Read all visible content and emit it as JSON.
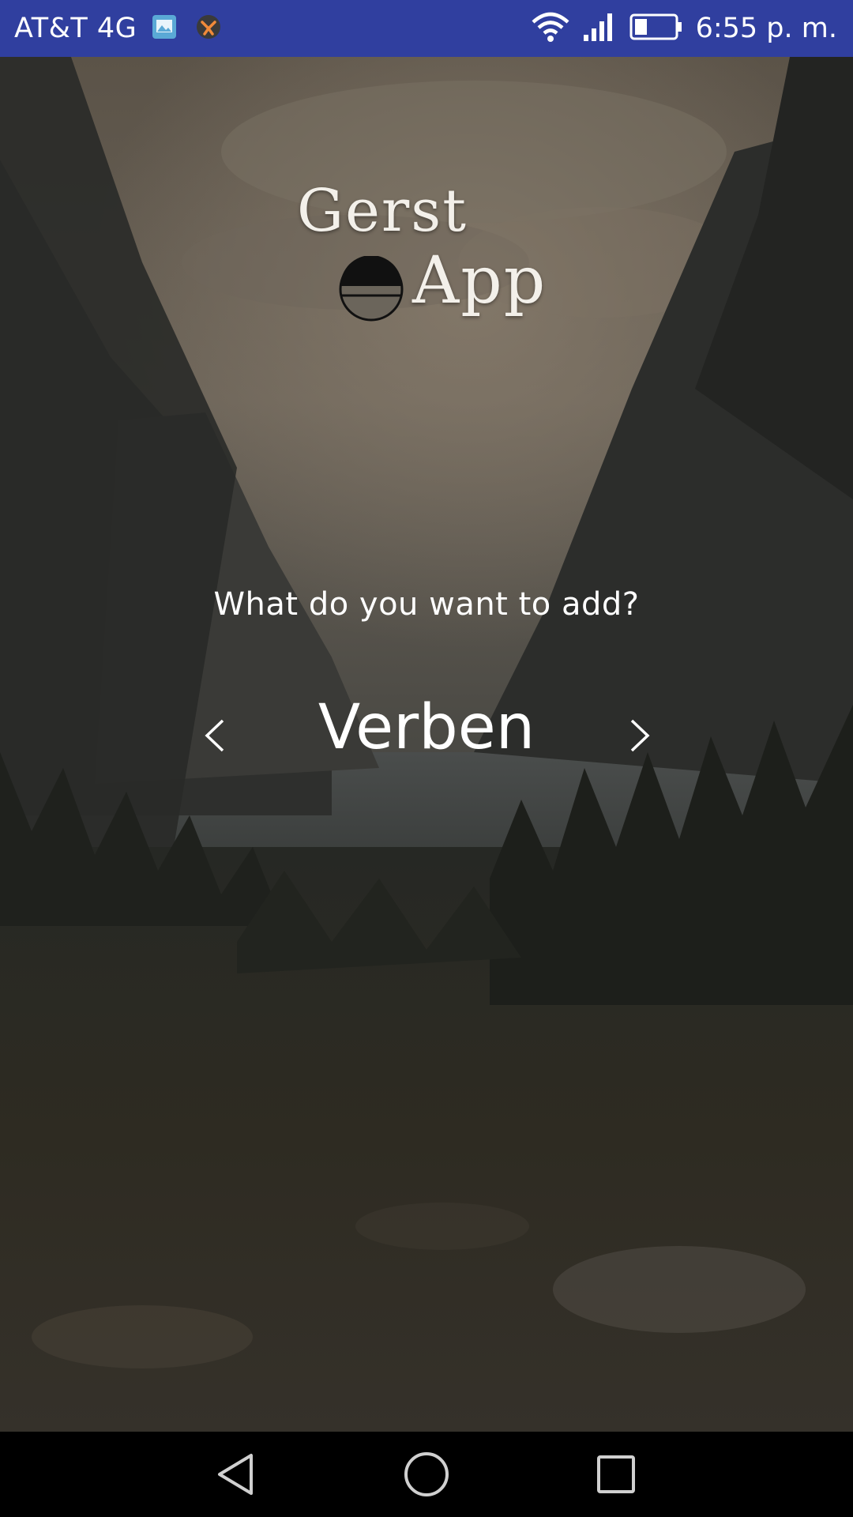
{
  "status_bar": {
    "carrier": "AT&T 4G",
    "time": "6:55 p. m.",
    "icons": [
      "gallery-icon",
      "app-notification-icon",
      "wifi-icon",
      "cell-signal-icon",
      "battery-icon"
    ]
  },
  "logo": {
    "line1": "Gerst",
    "line2": "App"
  },
  "main": {
    "question": "What do you want to add?",
    "selector": {
      "value": "Verben",
      "prev_icon": "chevron-left-icon",
      "next_icon": "chevron-right-icon"
    }
  },
  "nav_bar": {
    "icons": [
      "back-icon",
      "home-icon",
      "recents-icon"
    ]
  },
  "colors": {
    "status_bar": "#303f9f",
    "nav_bar": "#000000",
    "text": "#ffffff"
  }
}
